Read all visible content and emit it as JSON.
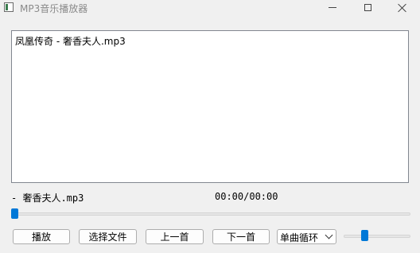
{
  "window": {
    "title": "MP3音乐播放器"
  },
  "playlist": {
    "items": [
      "凤凰传奇 - 奢香夫人.mp3"
    ]
  },
  "now_playing": {
    "label": "- 奢香夫人.mp3",
    "time": "00:00/00:00",
    "progress": 0.0
  },
  "controls": {
    "play_label": "播放",
    "choose_file_label": "选择文件",
    "prev_label": "上一首",
    "next_label": "下一首",
    "mode_selected": "单曲循环"
  },
  "volume": {
    "level": 0.25
  },
  "colors": {
    "accent": "#0078d7",
    "window_bg": "#f0f0f0"
  }
}
